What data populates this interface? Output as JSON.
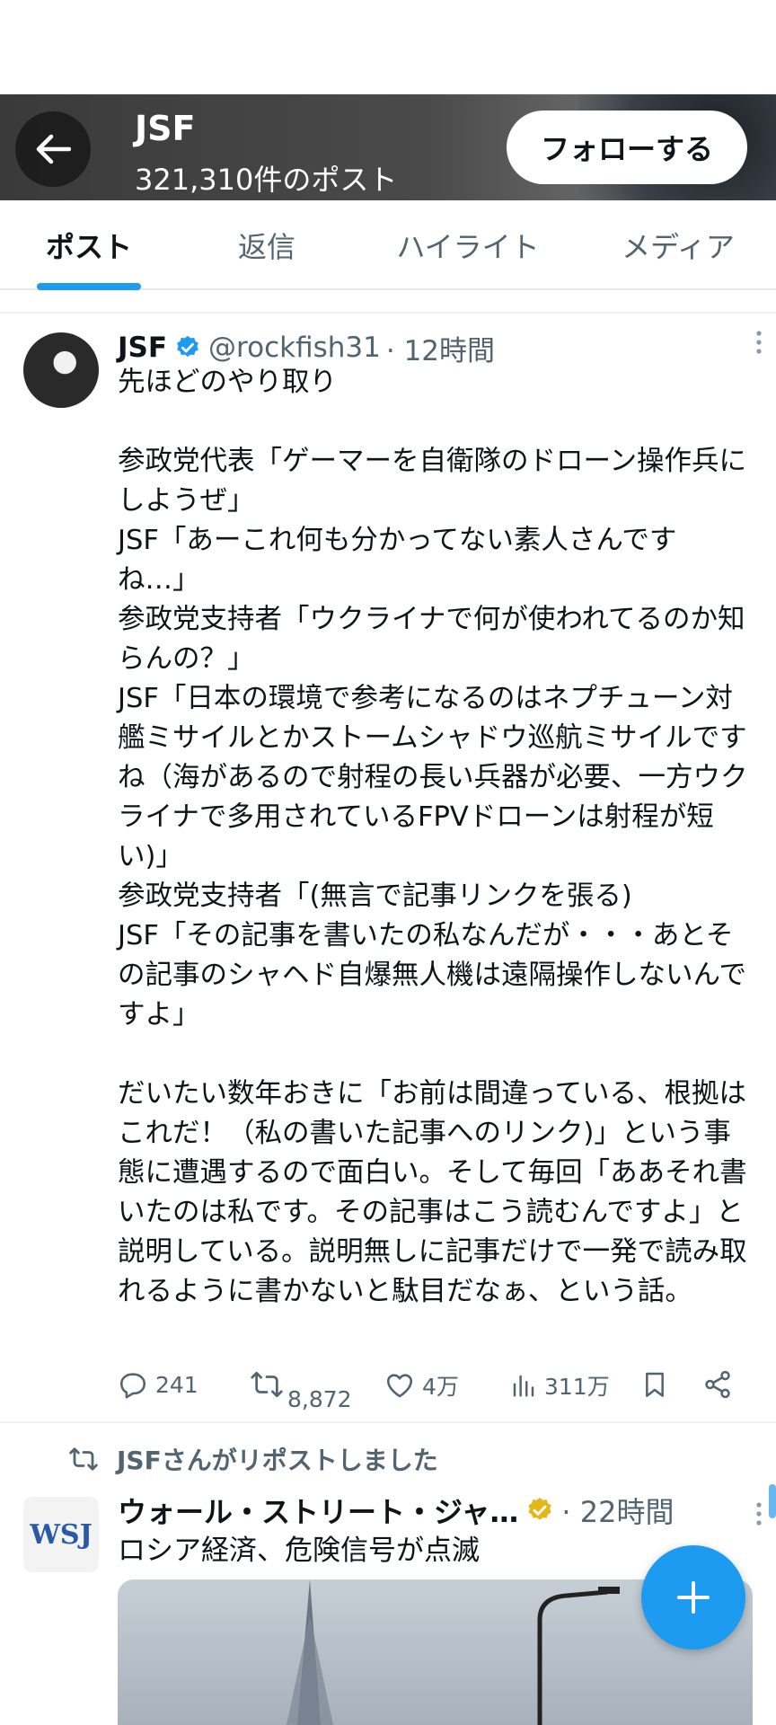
{
  "header": {
    "title": "JSF",
    "post_count": "321,310件のポスト",
    "follow_label": "フォローする"
  },
  "tabs": [
    {
      "label": "ポスト",
      "active": true
    },
    {
      "label": "返信",
      "active": false
    },
    {
      "label": "ハイライト",
      "active": false
    },
    {
      "label": "メディア",
      "active": false
    }
  ],
  "tweet": {
    "name": "JSF",
    "handle": "@rockfish31",
    "time": "· 12時間",
    "body": "先ほどのやり取り\n\n参政党代表「ゲーマーを自衛隊のドローン操作兵にしようぜ」\nJSF「あーこれ何も分かってない素人さんですね…」\n参政党支持者「ウクライナで何が使われてるのか知らんの？」\nJSF「日本の環境で参考になるのはネプチューン対艦ミサイルとかストームシャドウ巡航ミサイルですね（海があるので射程の長い兵器が必要、一方ウクライナで多用されているFPVドローンは射程が短い)」\n参政党支持者「(無言で記事リンクを張る)\nJSF「その記事を書いたの私なんだが・・・あとその記事のシャヘド自爆無人機は遠隔操作しないんですよ」\n\nだいたい数年おきに「お前は間違っている、根拠はこれだ！（私の書いた記事へのリンク)」という事態に遭遇するので面白い。そして毎回「ああそれ書いたのは私です。その記事はこう読むんですよ」と説明している。説明無しに記事だけで一発で読み取れるように書かないと駄目だなぁ、という話。",
    "replies": "241",
    "reposts": "8,872",
    "likes": "4万",
    "views": "311万"
  },
  "repost_label": "JSFさんがリポストしました",
  "tweet2": {
    "logo_text": "WSJ",
    "name": "ウォール・ストリート・ジャ…",
    "time": "· 22時間",
    "text": "ロシア経済、危険信号が点滅"
  },
  "colors": {
    "accent": "#1d9bf0",
    "muted": "#536471",
    "verified_blue": "#1d9bf0",
    "verified_gold": "#e2b719"
  }
}
